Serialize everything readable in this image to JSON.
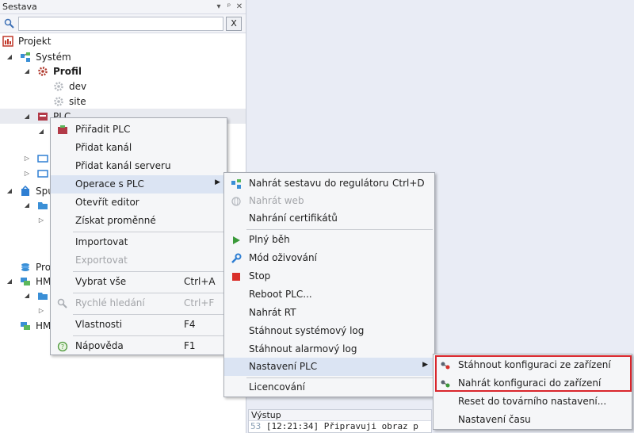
{
  "panel": {
    "title": "Sestava",
    "header_buttons": [
      "▾",
      "ᵖ",
      "✕"
    ],
    "search": {
      "value": "",
      "placeholder": "",
      "clear_label": "X"
    }
  },
  "tree": [
    {
      "label": "Projekt",
      "icon": "project-icon"
    },
    {
      "label": "Systém",
      "icon": "system-icon"
    },
    {
      "label": "Profil",
      "icon": "gear-red-icon"
    },
    {
      "label": "dev",
      "icon": "gear-icon"
    },
    {
      "label": "site",
      "icon": "gear-icon"
    },
    {
      "label": "PLC",
      "icon": "plc-icon"
    },
    {
      "label": "Spu",
      "icon": "app-icon"
    },
    {
      "label": "Pro",
      "icon": "stack-icon"
    },
    {
      "label": "HM",
      "icon": "hmi-icon"
    },
    {
      "label": "HM",
      "icon": "hmi-icon"
    }
  ],
  "menu1": {
    "items": [
      {
        "label": "Přiřadit PLC",
        "shortcut": ""
      },
      {
        "label": "Přidat kanál",
        "shortcut": ""
      },
      {
        "label": "Přidat kanál serveru",
        "shortcut": ""
      },
      {
        "label": "Operace s PLC",
        "shortcut": ""
      },
      {
        "label": "Otevřít editor",
        "shortcut": ""
      },
      {
        "label": "Získat proměnné",
        "shortcut": ""
      },
      {
        "label": "Importovat",
        "shortcut": ""
      },
      {
        "label": "Exportovat",
        "shortcut": ""
      },
      {
        "label": "Vybrat vše",
        "shortcut": "Ctrl+A"
      },
      {
        "label": "Rychlé hledání",
        "shortcut": "Ctrl+F"
      },
      {
        "label": "Vlastnosti",
        "shortcut": "F4"
      },
      {
        "label": "Nápověda",
        "shortcut": "F1"
      }
    ]
  },
  "menu2": {
    "items": [
      {
        "label": "Nahrát sestavu do regulátoru",
        "shortcut": "Ctrl+D"
      },
      {
        "label": "Nahrát web",
        "shortcut": ""
      },
      {
        "label": "Nahrání certifikátů",
        "shortcut": ""
      },
      {
        "label": "Plný běh",
        "shortcut": ""
      },
      {
        "label": "Mód oživování",
        "shortcut": ""
      },
      {
        "label": "Stop",
        "shortcut": ""
      },
      {
        "label": "Reboot PLC...",
        "shortcut": ""
      },
      {
        "label": "Nahrát RT",
        "shortcut": ""
      },
      {
        "label": "Stáhnout systémový log",
        "shortcut": ""
      },
      {
        "label": "Stáhnout alarmový log",
        "shortcut": ""
      },
      {
        "label": "Nastavení PLC",
        "shortcut": ""
      },
      {
        "label": "Licencování",
        "shortcut": ""
      }
    ]
  },
  "menu3": {
    "items": [
      {
        "label": "Stáhnout konfiguraci ze zařízení"
      },
      {
        "label": "Nahrát konfiguraci do zařízení"
      },
      {
        "label": "Reset do továrního nastavení..."
      },
      {
        "label": "Nastavení času"
      }
    ]
  },
  "output": {
    "title": "Výstup",
    "line_num": "53",
    "line_text": "[12:21:34] Připravuji obraz p"
  },
  "colors": {
    "highlight_box": "#d9262c",
    "menu_hover": "#dbe4f3",
    "menu_bg": "#f5f6f8"
  }
}
